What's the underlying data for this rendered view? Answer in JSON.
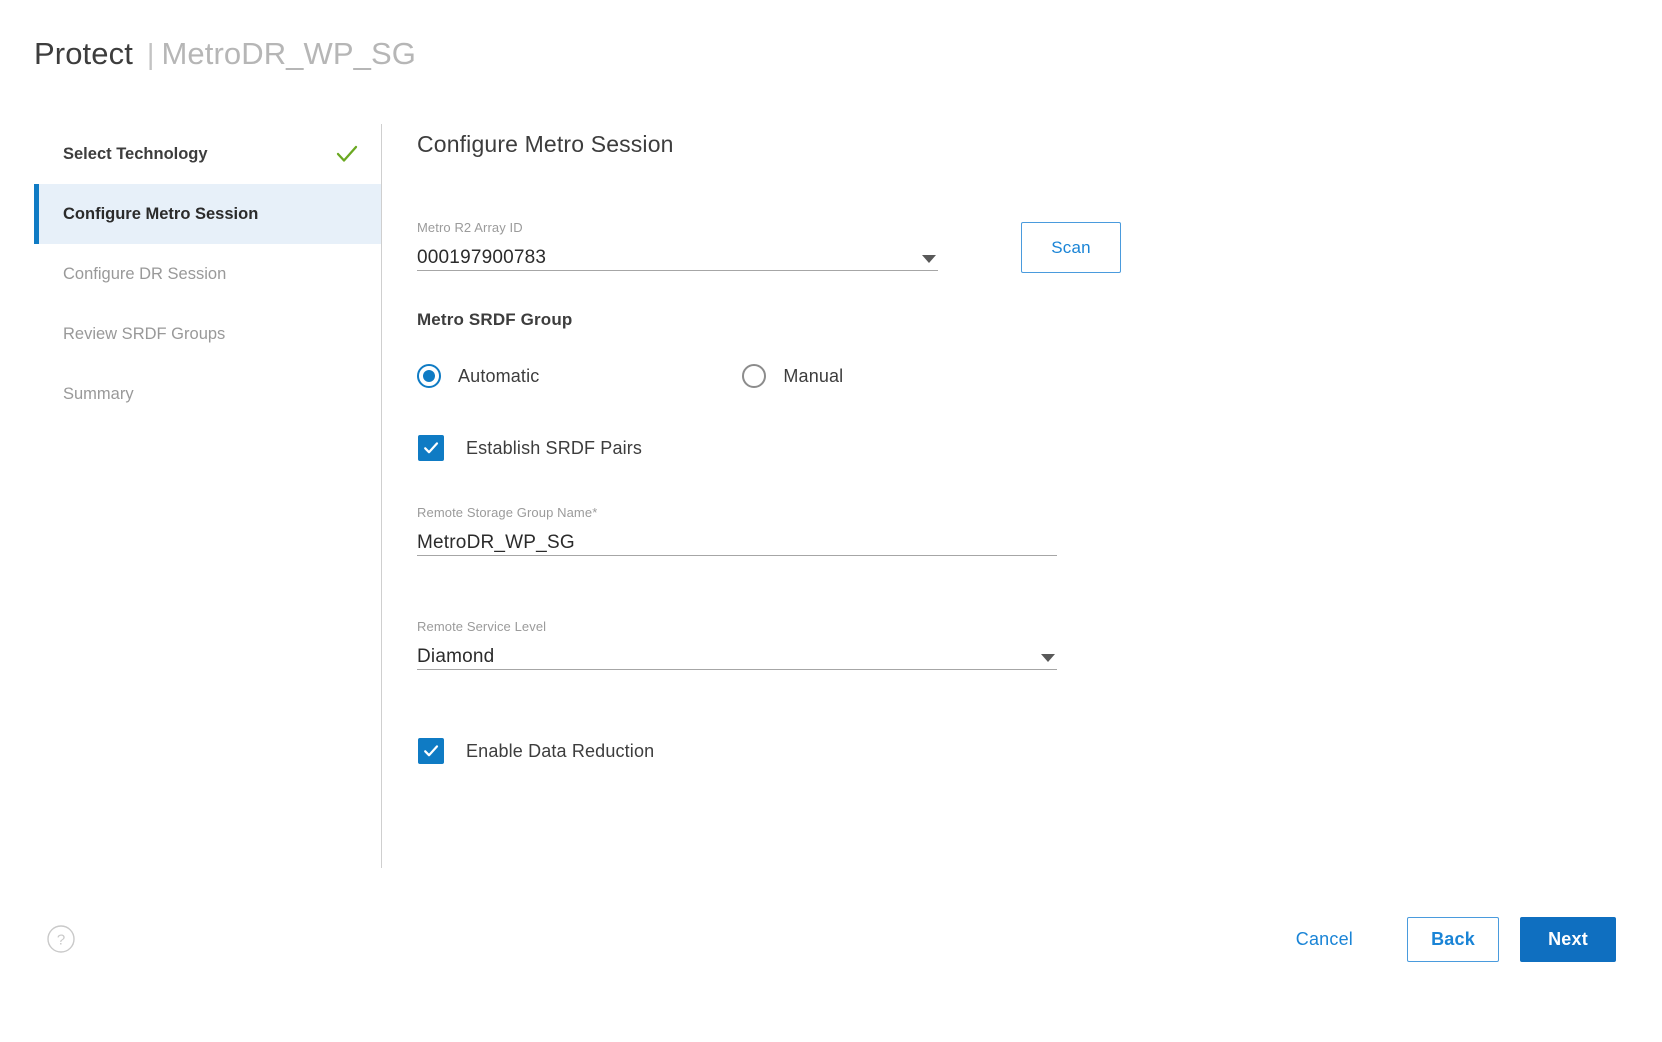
{
  "header": {
    "title": "Protect",
    "separator": "|",
    "subject": "MetroDR_WP_SG"
  },
  "sidebar": {
    "items": [
      {
        "label": "Select Technology",
        "state": "done",
        "icon": "check-icon"
      },
      {
        "label": "Configure Metro Session",
        "state": "active",
        "icon": ""
      },
      {
        "label": "Configure DR Session",
        "state": "upcoming",
        "icon": ""
      },
      {
        "label": "Review SRDF Groups",
        "state": "upcoming",
        "icon": ""
      },
      {
        "label": "Summary",
        "state": "upcoming",
        "icon": ""
      }
    ]
  },
  "content": {
    "title": "Configure Metro Session",
    "array_id": {
      "label": "Metro R2 Array ID",
      "value": "000197900783",
      "placeholder": "",
      "options": [
        "000197900783"
      ]
    },
    "scan_button": "Scan",
    "srdf_group": {
      "heading": "Metro SRDF Group",
      "options": [
        {
          "label": "Automatic",
          "selected": true
        },
        {
          "label": "Manual",
          "selected": false
        }
      ]
    },
    "establish_pairs": {
      "label": "Establish SRDF Pairs",
      "checked": true
    },
    "remote_sg_name": {
      "label": "Remote Storage Group Name*",
      "value": "MetroDR_WP_SG",
      "placeholder": ""
    },
    "remote_service_level": {
      "label": "Remote Service Level",
      "value": "Diamond",
      "options": [
        "Diamond"
      ]
    },
    "data_reduction": {
      "label": "Enable Data Reduction",
      "checked": true
    }
  },
  "footer": {
    "help_icon": "help-circle-icon",
    "cancel_label": "Cancel",
    "back_label": "Back",
    "next_label": "Next"
  },
  "colors": {
    "accent_blue": "#0f7bc4",
    "link_blue": "#1a84d6",
    "primary_button": "#0f6fc0",
    "active_step_bg": "#e7f0f9",
    "check_green": "#6aa821",
    "muted_text": "#9b9b9b"
  }
}
